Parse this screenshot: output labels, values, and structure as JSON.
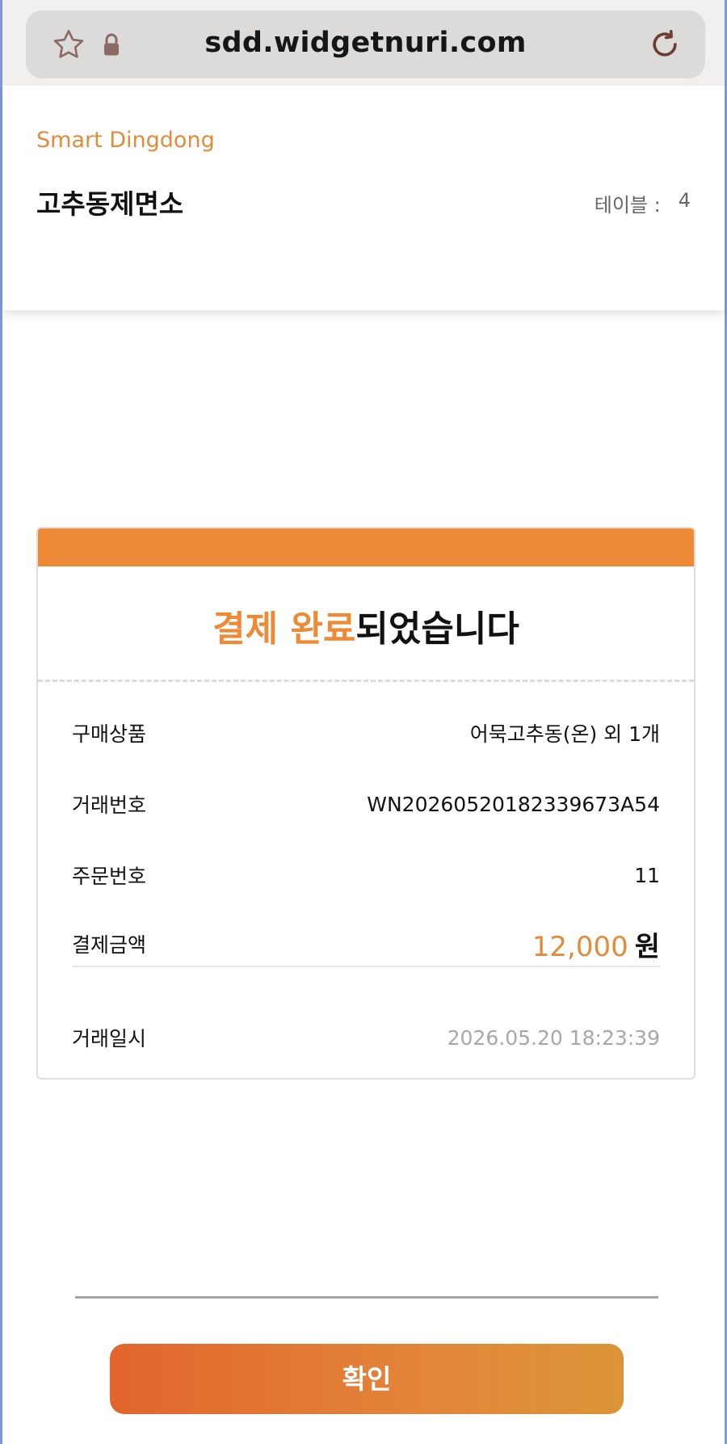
{
  "browser": {
    "url": "sdd.widgetnuri.com",
    "icons": {
      "favorite": "star-icon",
      "secure": "lock-icon",
      "reload": "reload-icon"
    }
  },
  "header": {
    "brand": "Smart Dingdong",
    "store_name": "고추동제면소",
    "table_label": "테이블 :",
    "table_number": "4"
  },
  "receipt": {
    "title_accent": "결제 완료",
    "title_rest": "되었습니다",
    "rows": [
      {
        "label": "구매상품",
        "value": "어묵고추동(온) 외 1개"
      },
      {
        "label": "거래번호",
        "value": "WN20260520182339673A54"
      },
      {
        "label": "주문번호",
        "value": "11"
      }
    ],
    "amount": {
      "label": "결제금액",
      "value": "12,000",
      "unit": "원"
    },
    "date": {
      "label": "거래일시",
      "value": "2026.05.20 18:23:39"
    }
  },
  "actions": {
    "confirm_label": "확인"
  },
  "colors": {
    "accent": "#ee8a35",
    "button_start": "#e2652c",
    "button_end": "#dc9438"
  }
}
